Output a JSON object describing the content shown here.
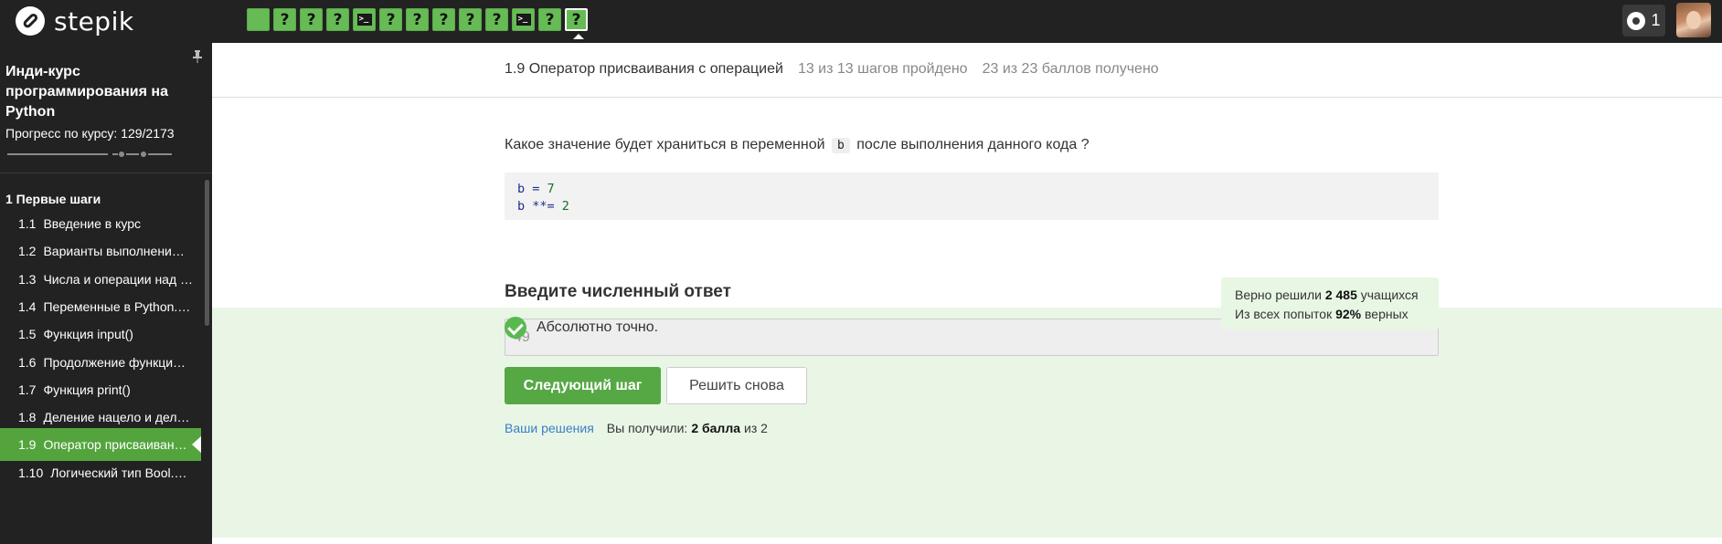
{
  "header": {
    "logo_text": "stepik",
    "steps": [
      {
        "type": "done",
        "symbol": ""
      },
      {
        "type": "quiz",
        "symbol": "?"
      },
      {
        "type": "quiz",
        "symbol": "?"
      },
      {
        "type": "quiz",
        "symbol": "?"
      },
      {
        "type": "code",
        "symbol": ">_"
      },
      {
        "type": "quiz",
        "symbol": "?"
      },
      {
        "type": "quiz",
        "symbol": "?"
      },
      {
        "type": "quiz",
        "symbol": "?"
      },
      {
        "type": "quiz",
        "symbol": "?"
      },
      {
        "type": "quiz",
        "symbol": "?"
      },
      {
        "type": "code",
        "symbol": ">_"
      },
      {
        "type": "quiz",
        "symbol": "?"
      },
      {
        "type": "quiz",
        "symbol": "?"
      }
    ],
    "notifications_count": "1"
  },
  "sidebar": {
    "course_title": "Инди-курс программирования на Python",
    "progress_label": "Прогресс по курсу:",
    "progress_value": "129/2173",
    "section_title": "1  Первые шаги",
    "lessons": [
      {
        "num": "1.1",
        "label": "Введение в курс"
      },
      {
        "num": "1.2",
        "label": "Варианты выполнени…"
      },
      {
        "num": "1.3",
        "label": "Числа и операции над …"
      },
      {
        "num": "1.4",
        "label": "Переменные в Python.…"
      },
      {
        "num": "1.5",
        "label": "Функция input()"
      },
      {
        "num": "1.6",
        "label": "Продолжение функци…"
      },
      {
        "num": "1.7",
        "label": "Функция print()"
      },
      {
        "num": "1.8",
        "label": "Деление нацело и дел…"
      },
      {
        "num": "1.9",
        "label": "Оператор присваиван…"
      },
      {
        "num": "1.10",
        "label": "Логический тип Bool.…"
      }
    ],
    "active_lesson": 8
  },
  "breadcrumb": {
    "lesson": "1.9 Оператор присваивания с операцией",
    "steps_done": "13 из 13 шагов пройдено",
    "points": "23 из 23 баллов  получено"
  },
  "question": {
    "prefix": "Какое значение будет храниться в переменной",
    "var": "b",
    "suffix": "после выполнения данного кода ?",
    "code_line1_a": "b = ",
    "code_line1_b": "7",
    "code_line2_a": "b **= ",
    "code_line2_b": "2"
  },
  "answer": {
    "heading": "Введите численный ответ",
    "feedback": "Абсолютно точно.",
    "value": "49",
    "next_button": "Следующий шаг",
    "retry_button": "Решить снова"
  },
  "stats": {
    "solved_prefix": "Верно решили",
    "solved_count": "2 485",
    "solved_suffix": "учащихся",
    "attempts_prefix": "Из всех попыток",
    "attempts_percent": "92%",
    "attempts_suffix": "верных"
  },
  "solutions": {
    "link": "Ваши решения",
    "received_prefix": "Вы получили:",
    "received_value": "2 балла",
    "received_suffix": "из 2"
  },
  "colors": {
    "topbar": "#222222",
    "accent_green": "#56a845",
    "band_green": "#e9f6e6"
  }
}
